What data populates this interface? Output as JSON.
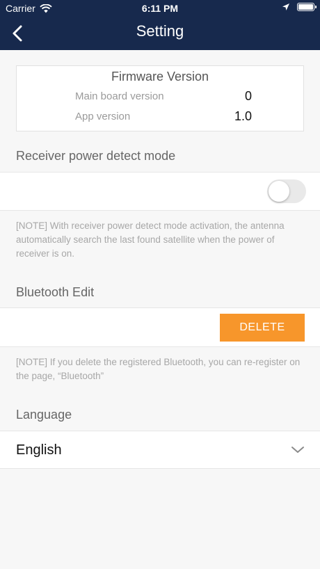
{
  "status_bar": {
    "carrier": "Carrier",
    "time": "6:11 PM"
  },
  "header": {
    "title": "Setting",
    "background": "#17294d"
  },
  "firmware": {
    "title": "Firmware Version",
    "rows": [
      {
        "label": "Main board version",
        "value": "0"
      },
      {
        "label": "App version",
        "value": "1.0"
      }
    ]
  },
  "power_detect": {
    "label": "Receiver power detect mode",
    "enabled": false,
    "note": "[NOTE] With receiver power detect mode activation, the antenna automatically search the last found satellite when the power of receiver is on."
  },
  "bluetooth": {
    "label": "Bluetooth Edit",
    "delete_label": "DELETE",
    "accent": "#f7962b",
    "note": "[NOTE] If you delete the registered Bluetooth, you can re-register on the page, “Bluetooth”"
  },
  "language": {
    "label": "Language",
    "selected": "English"
  }
}
